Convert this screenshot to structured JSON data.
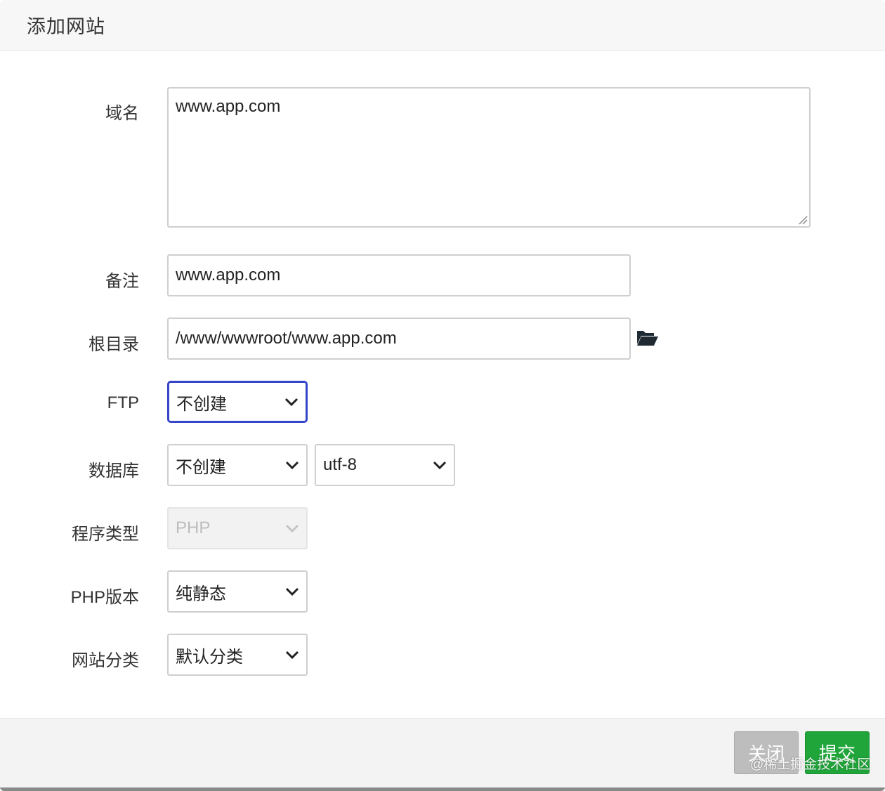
{
  "dialog": {
    "title": "添加网站"
  },
  "form": {
    "domain": {
      "label": "域名",
      "value": "www.app.com"
    },
    "remark": {
      "label": "备注",
      "value": "www.app.com"
    },
    "root_dir": {
      "label": "根目录",
      "value": "/www/wwwroot/www.app.com",
      "icon": "folder-open-icon"
    },
    "ftp": {
      "label": "FTP",
      "selected": "不创建"
    },
    "database": {
      "label": "数据库",
      "selected": "不创建",
      "charset_selected": "utf-8"
    },
    "program_type": {
      "label": "程序类型",
      "selected": "PHP",
      "disabled": true
    },
    "php_version": {
      "label": "PHP版本",
      "selected": "纯静态"
    },
    "site_category": {
      "label": "网站分类",
      "selected": "默认分类"
    }
  },
  "footer": {
    "close_label": "关闭",
    "submit_label": "提交"
  },
  "watermark": "@稀土掘金技术社区",
  "colors": {
    "submit_green": "#20a53a",
    "close_gray": "#bdbdbd",
    "focus_blue": "#3445c8"
  }
}
